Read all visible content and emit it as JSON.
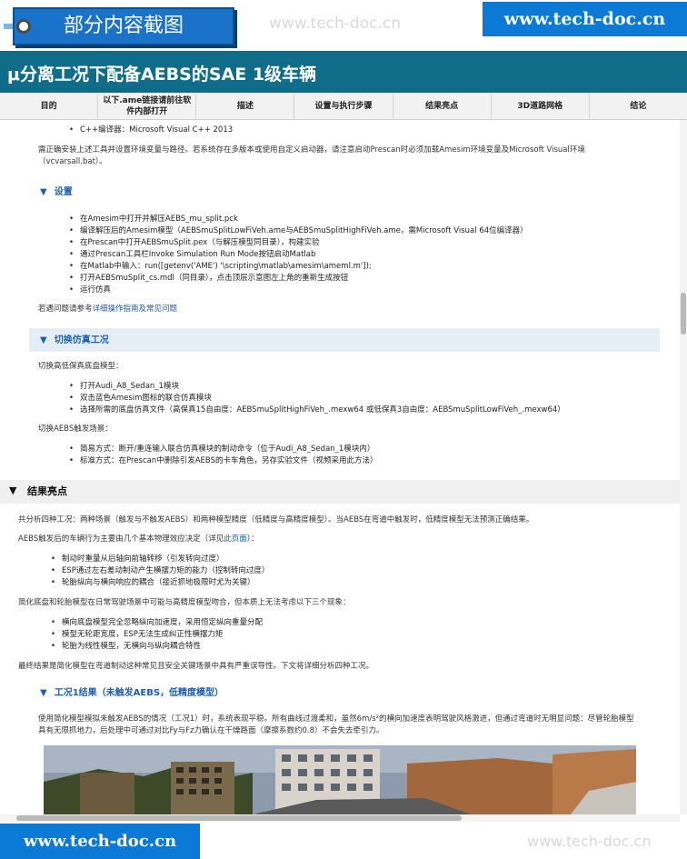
{
  "header": {
    "badge_label": "部分内容截图",
    "watermark_top": "www.tech-doc.cn",
    "site_badge": "www.tech-doc.cn",
    "page_title": "μ分离工况下配备AEBS的SAE 1级车辆"
  },
  "nav": {
    "tabs": [
      "目的",
      "以下.ame链接请前往软件内部打开",
      "描述",
      "设置与执行步骤",
      "结果亮点",
      "3D道路网格",
      "结论"
    ]
  },
  "content": {
    "req_item": "C++编译器：Microsoft Visual C++ 2013",
    "env_note": "需正确安装上述工具并设置环境变量与路径。若系统存在多版本或使用自定义启动器，请注意启动Prescan时必须加载Amesim环境变量及Microsoft Visual环境（vcvarsall.bat）。",
    "setup": {
      "title": "设置",
      "steps": [
        "在Amesim中打开并解压AEBS_mu_split.pck",
        "编译解压后的Amesim模型（AEBSmuSplitLowFiVeh.ame与AEBSmuSplitHighFiVeh.ame，需Microsoft Visual 64位编译器）",
        "在Prescan中打开AEBSmuSplit.pex（与解压模型同目录），构建实验",
        "通过Prescan工具栏Invoke Simulation Run Mode按钮启动Matlab",
        "在Matlab中输入：run([getenv('AME') '\\scripting\\matlab\\amesim\\ameml.m']);",
        "打开AEBSmuSplit_cs.mdl（同目录），点击顶层示意图左上角的重新生成按钮",
        "运行仿真"
      ],
      "help_prefix": "若遇问题请参考",
      "help_link": "详细操作指南及常见问题"
    },
    "switch": {
      "title": "切换仿真工况",
      "intro": "切换高低保真底盘模型：",
      "steps": [
        "打开Audi_A8_Sedan_1模块",
        "双击蓝色Amesim图标的联合仿真模块",
        "选择所需的底盘仿真文件（高保真15自由度：AEBSmuSplitHighFiVeh_.mexw64 或低保真3自由度：AEBSmuSplitLowFiVeh_.mexw64）"
      ],
      "trigger_intro": "切换AEBS触发场景：",
      "trigger_steps": [
        "简易方式：断开/重连输入联合仿真模块的制动命令（位于Audi_A8_Sedan_1模块内）",
        "标准方式：在Prescan中删除引发AEBS的卡车角色，另存实验文件（视频采用此方法）"
      ]
    },
    "results": {
      "title": "结果亮点",
      "summary": "共分析四种工况：两种场景（触发与不触发AEBS）和两种模型精度（低精度与高精度模型）。当AEBS在弯道中触发时，低精度模型无法预测正确结果。",
      "mech_prefix": "AEBS触发后的车辆行为主要由几个基本物理效应决定（详见",
      "mech_link": "此页面",
      "mech_suffix": "）：",
      "mech_items": [
        "制动时重量从后轴向前轴转移（引发转向过度）",
        "ESP通过左右差动制动产生横摆力矩的能力（控制转向过度）",
        "轮胎纵向与横向响应的耦合（接近抓地极限时尤为关键）"
      ],
      "simplified_intro": "简化底盘和轮胎模型在日常驾驶场景中可能与高精度模型吻合，但本质上无法考虑以下三个现象：",
      "simplified_items": [
        "横向底盘模型完全忽略纵向加速度，采用恒定纵向重量分配",
        "模型无轮距宽度，ESP无法生成纠正性横摆力矩",
        "轮胎为线性模型，无横向与纵向耦合特性"
      ],
      "conclusion": "最终结果是简化模型在弯道制动这种常见且安全关键场景中具有严重误导性。下文将详细分析四种工况。",
      "case1_title": "工况1结果（未触发AEBS，低精度模型）",
      "case1_text": "使用简化模型模拟未触发AEBS的情况（工况1）时，系统表现平稳。所有曲线过渡柔和，虽然6m/s²的横向加速度表明驾驶风格激进，但通过弯道时无明显问题：尽管轮胎模型具有无限抓地力，后处理中可通过对比Fy与Fz力确认在干燥路面（摩擦系数约0.8）不会失去牵引力。"
    }
  },
  "footer": {
    "site_badge": "www.tech-doc.cn",
    "watermark_bottom": "www.tech-doc.cn"
  }
}
